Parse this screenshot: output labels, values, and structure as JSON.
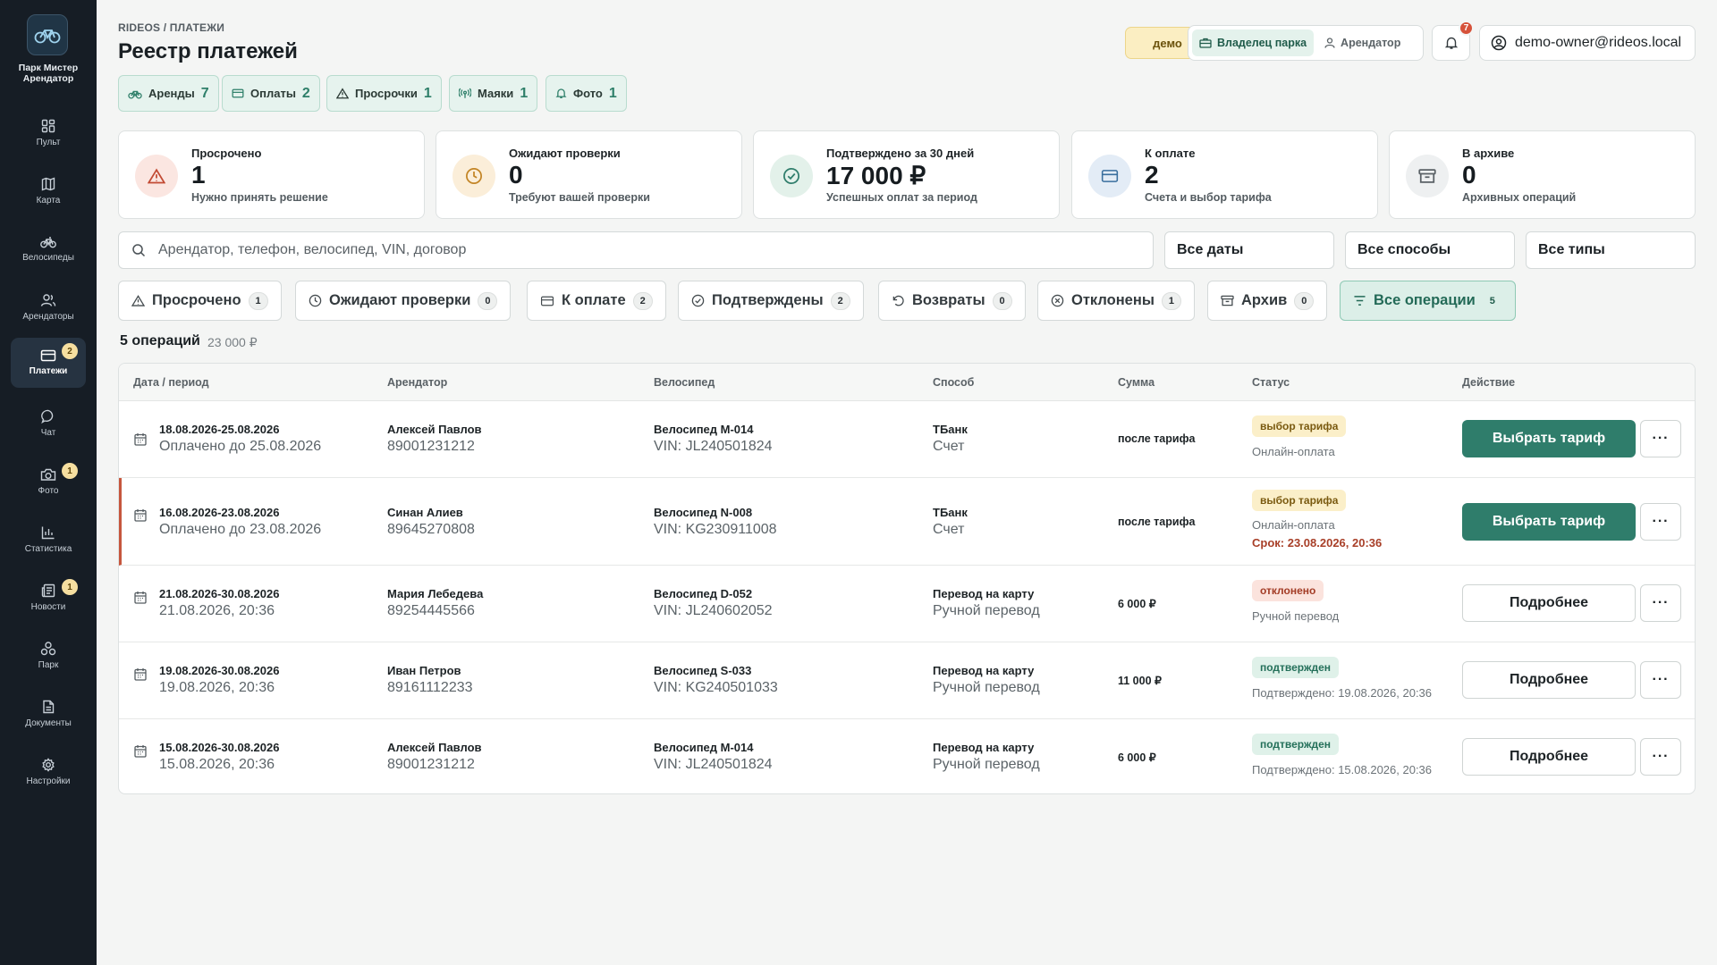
{
  "sidebar": {
    "brand": "Парк Мистер Арендатор",
    "items": [
      {
        "label": "Пульт",
        "icon": "dashboard-icon"
      },
      {
        "label": "Карта",
        "icon": "map-icon"
      },
      {
        "label": "Велосипеды",
        "icon": "bike-icon"
      },
      {
        "label": "Арендаторы",
        "icon": "users-icon"
      },
      {
        "label": "Платежи",
        "icon": "card-icon",
        "badge": "2",
        "active": true
      },
      {
        "label": "Чат",
        "icon": "chat-icon"
      },
      {
        "label": "Фото",
        "icon": "camera-icon",
        "badge": "1"
      },
      {
        "label": "Статистика",
        "icon": "chart-icon"
      },
      {
        "label": "Новости",
        "icon": "news-icon",
        "badge": "1"
      },
      {
        "label": "Парк",
        "icon": "park-icon"
      },
      {
        "label": "Документы",
        "icon": "document-icon"
      },
      {
        "label": "Настройки",
        "icon": "settings-icon"
      }
    ]
  },
  "header": {
    "breadcrumb": "RIDEOS / ПЛАТЕЖИ",
    "title": "Реестр платежей",
    "demo": "демо",
    "roles": [
      "Владелец парка",
      "Арендатор"
    ],
    "notifications": "7",
    "user": "demo-owner@rideos.local"
  },
  "pills": [
    {
      "label": "Аренды",
      "count": "7",
      "icon": "bike-icon"
    },
    {
      "label": "Оплаты",
      "count": "2",
      "icon": "card-icon"
    },
    {
      "label": "Просрочки",
      "count": "1",
      "icon": "warning-icon"
    },
    {
      "label": "Маяки",
      "count": "1",
      "icon": "beacon-icon"
    },
    {
      "label": "Фото",
      "count": "1",
      "icon": "bell-icon"
    }
  ],
  "stats": [
    {
      "label": "Просрочено",
      "value": "1",
      "sub": "Нужно принять решение",
      "icon": "warning-icon",
      "color": "#fbe6e1",
      "iconColor": "#c24a33"
    },
    {
      "label": "Ожидают проверки",
      "value": "0",
      "sub": "Требуют вашей проверки",
      "icon": "clock-icon",
      "color": "#fbeed9",
      "iconColor": "#c38526"
    },
    {
      "label": "Подтверждено за 30 дней",
      "value": "17 000 ₽",
      "sub": "Успешных оплат за период",
      "icon": "check-circle-icon",
      "color": "#e3f1ea",
      "iconColor": "#2f7d6b"
    },
    {
      "label": "К оплате",
      "value": "2",
      "sub": "Счета и выбор тарифа",
      "icon": "card-icon",
      "color": "#e3ecf6",
      "iconColor": "#3a6f9e"
    },
    {
      "label": "В архиве",
      "value": "0",
      "sub": "Архивных операций",
      "icon": "archive-icon",
      "color": "#eef0f1",
      "iconColor": "#5a6166"
    }
  ],
  "search": {
    "placeholder": "Арендатор, телефон, велосипед, VIN, договор"
  },
  "selects": [
    "Все даты",
    "Все способы",
    "Все типы"
  ],
  "tabs": [
    {
      "label": "Просрочено",
      "count": "1",
      "icon": "warning-icon"
    },
    {
      "label": "Ожидают проверки",
      "count": "0",
      "icon": "clock-icon"
    },
    {
      "label": "К оплате",
      "count": "2",
      "icon": "card-icon"
    },
    {
      "label": "Подтверждены",
      "count": "2",
      "icon": "check-circle-icon"
    },
    {
      "label": "Возвраты",
      "count": "0",
      "icon": "refund-icon"
    },
    {
      "label": "Отклонены",
      "count": "1",
      "icon": "x-circle-icon"
    },
    {
      "label": "Архив",
      "count": "0",
      "icon": "archive-icon"
    },
    {
      "label": "Все операции",
      "count": "5",
      "icon": "filter-icon",
      "active": true
    }
  ],
  "summary": {
    "count": "5 операций",
    "total": "23 000 ₽"
  },
  "table": {
    "headers": [
      "Дата / период",
      "Арендатор",
      "Велосипед",
      "Способ",
      "Сумма",
      "Статус",
      "Действие"
    ],
    "rows": [
      {
        "period": "18.08.2026-25.08.2026",
        "period_sub": "Оплачено до 25.08.2026",
        "tenant": "Алексей Павлов",
        "phone": "89001231212",
        "bike": "Велосипед M-014",
        "vin": "VIN: JL240501824",
        "method": "ТБанк",
        "method_sub": "Счет",
        "amount": "после тарифа",
        "status": "выбор тарифа",
        "status_type": "tariff",
        "status_sub": "Онлайн-оплата",
        "deadline": "",
        "action": "Выбрать тариф",
        "action_type": "primary",
        "more": "···"
      },
      {
        "period": "16.08.2026-23.08.2026",
        "period_sub": "Оплачено до 23.08.2026",
        "tenant": "Синан Алиев",
        "phone": "89645270808",
        "bike": "Велосипед N-008",
        "vin": "VIN: KG230911008",
        "method": "ТБанк",
        "method_sub": "Счет",
        "amount": "после тарифа",
        "status": "выбор тарифа",
        "status_type": "tariff",
        "status_sub": "Онлайн-оплата",
        "deadline": "Срок: 23.08.2026, 20:36",
        "action": "Выбрать тариф",
        "action_type": "primary",
        "more": "···"
      },
      {
        "period": "21.08.2026-30.08.2026",
        "period_sub": "21.08.2026, 20:36",
        "tenant": "Мария Лебедева",
        "phone": "89254445566",
        "bike": "Велосипед D-052",
        "vin": "VIN: JL240602052",
        "method": "Перевод на карту",
        "method_sub": "Ручной перевод",
        "amount": "6 000 ₽",
        "status": "отклонено",
        "status_type": "rej",
        "status_sub": "Ручной перевод",
        "deadline": "",
        "action": "Подробнее",
        "action_type": "secondary",
        "more": "···"
      },
      {
        "period": "19.08.2026-30.08.2026",
        "period_sub": "19.08.2026, 20:36",
        "tenant": "Иван Петров",
        "phone": "89161112233",
        "bike": "Велосипед S-033",
        "vin": "VIN: KG240501033",
        "method": "Перевод на карту",
        "method_sub": "Ручной перевод",
        "amount": "11 000 ₽",
        "status": "подтвержден",
        "status_type": "ok",
        "status_sub": "Подтверждено: 19.08.2026, 20:36",
        "deadline": "",
        "action": "Подробнее",
        "action_type": "secondary",
        "more": "···"
      },
      {
        "period": "15.08.2026-30.08.2026",
        "period_sub": "15.08.2026, 20:36",
        "tenant": "Алексей Павлов",
        "phone": "89001231212",
        "bike": "Велосипед M-014",
        "vin": "VIN: JL240501824",
        "method": "Перевод на карту",
        "method_sub": "Ручной перевод",
        "amount": "6 000 ₽",
        "status": "подтвержден",
        "status_type": "ok",
        "status_sub": "Подтверждено: 15.08.2026, 20:36",
        "deadline": "",
        "action": "Подробнее",
        "action_type": "secondary",
        "more": "···"
      }
    ]
  }
}
